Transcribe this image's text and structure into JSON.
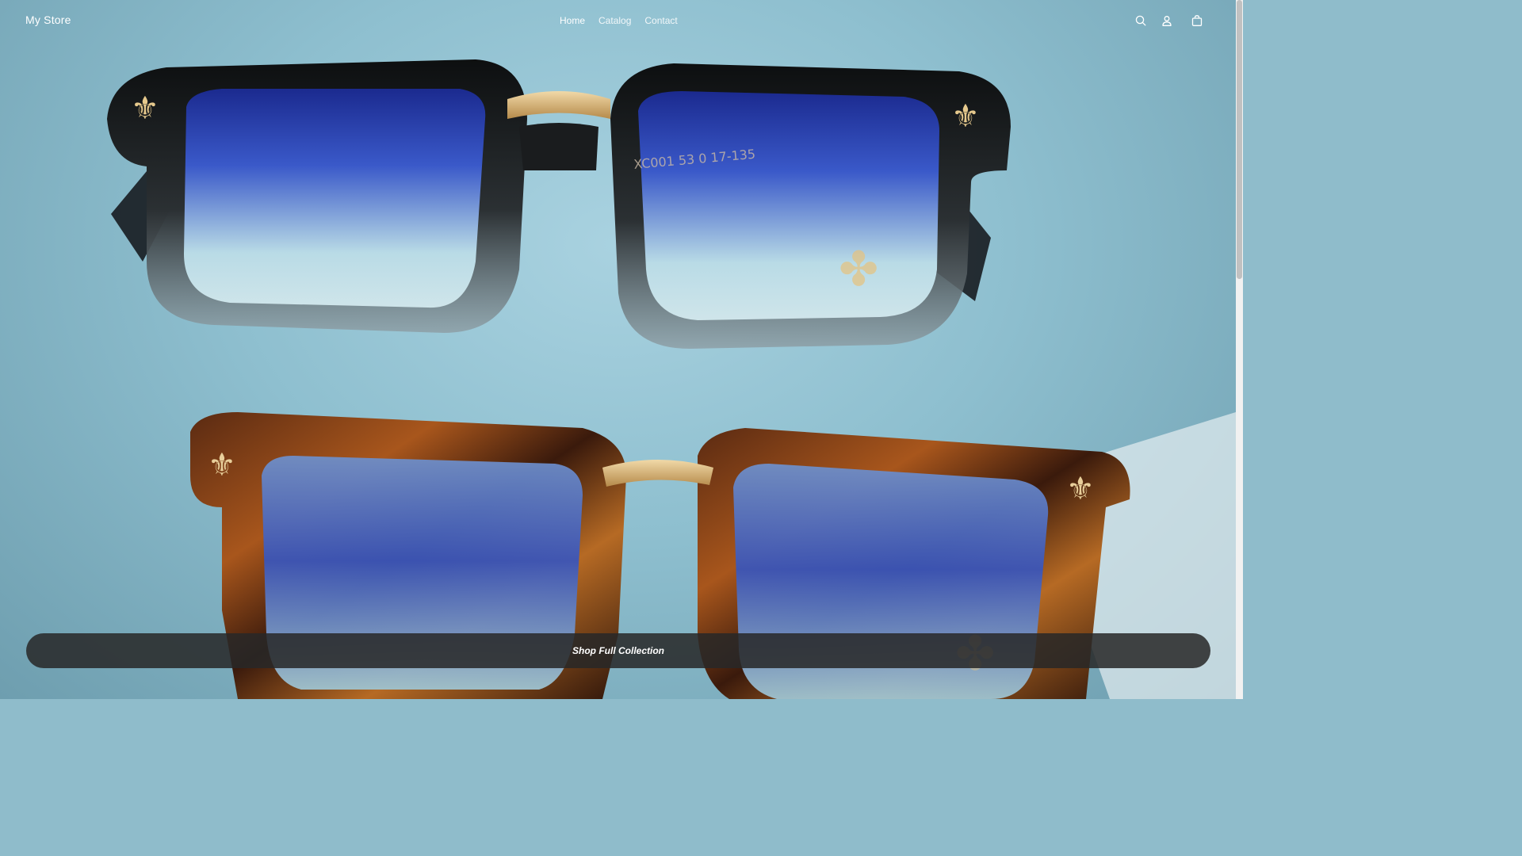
{
  "header": {
    "logo": "My Store",
    "nav": [
      {
        "label": "Home",
        "active": true
      },
      {
        "label": "Catalog",
        "active": false
      },
      {
        "label": "Contact",
        "active": false
      }
    ],
    "icons": [
      "search-icon",
      "account-icon",
      "cart-icon"
    ]
  },
  "hero": {
    "frame_imprint": "XC001 53 0 17-135",
    "cta_label": "Shop Full Collection"
  },
  "colors": {
    "cta_background": "#282828",
    "background": "#8fbccb",
    "text": "#ffffff"
  }
}
